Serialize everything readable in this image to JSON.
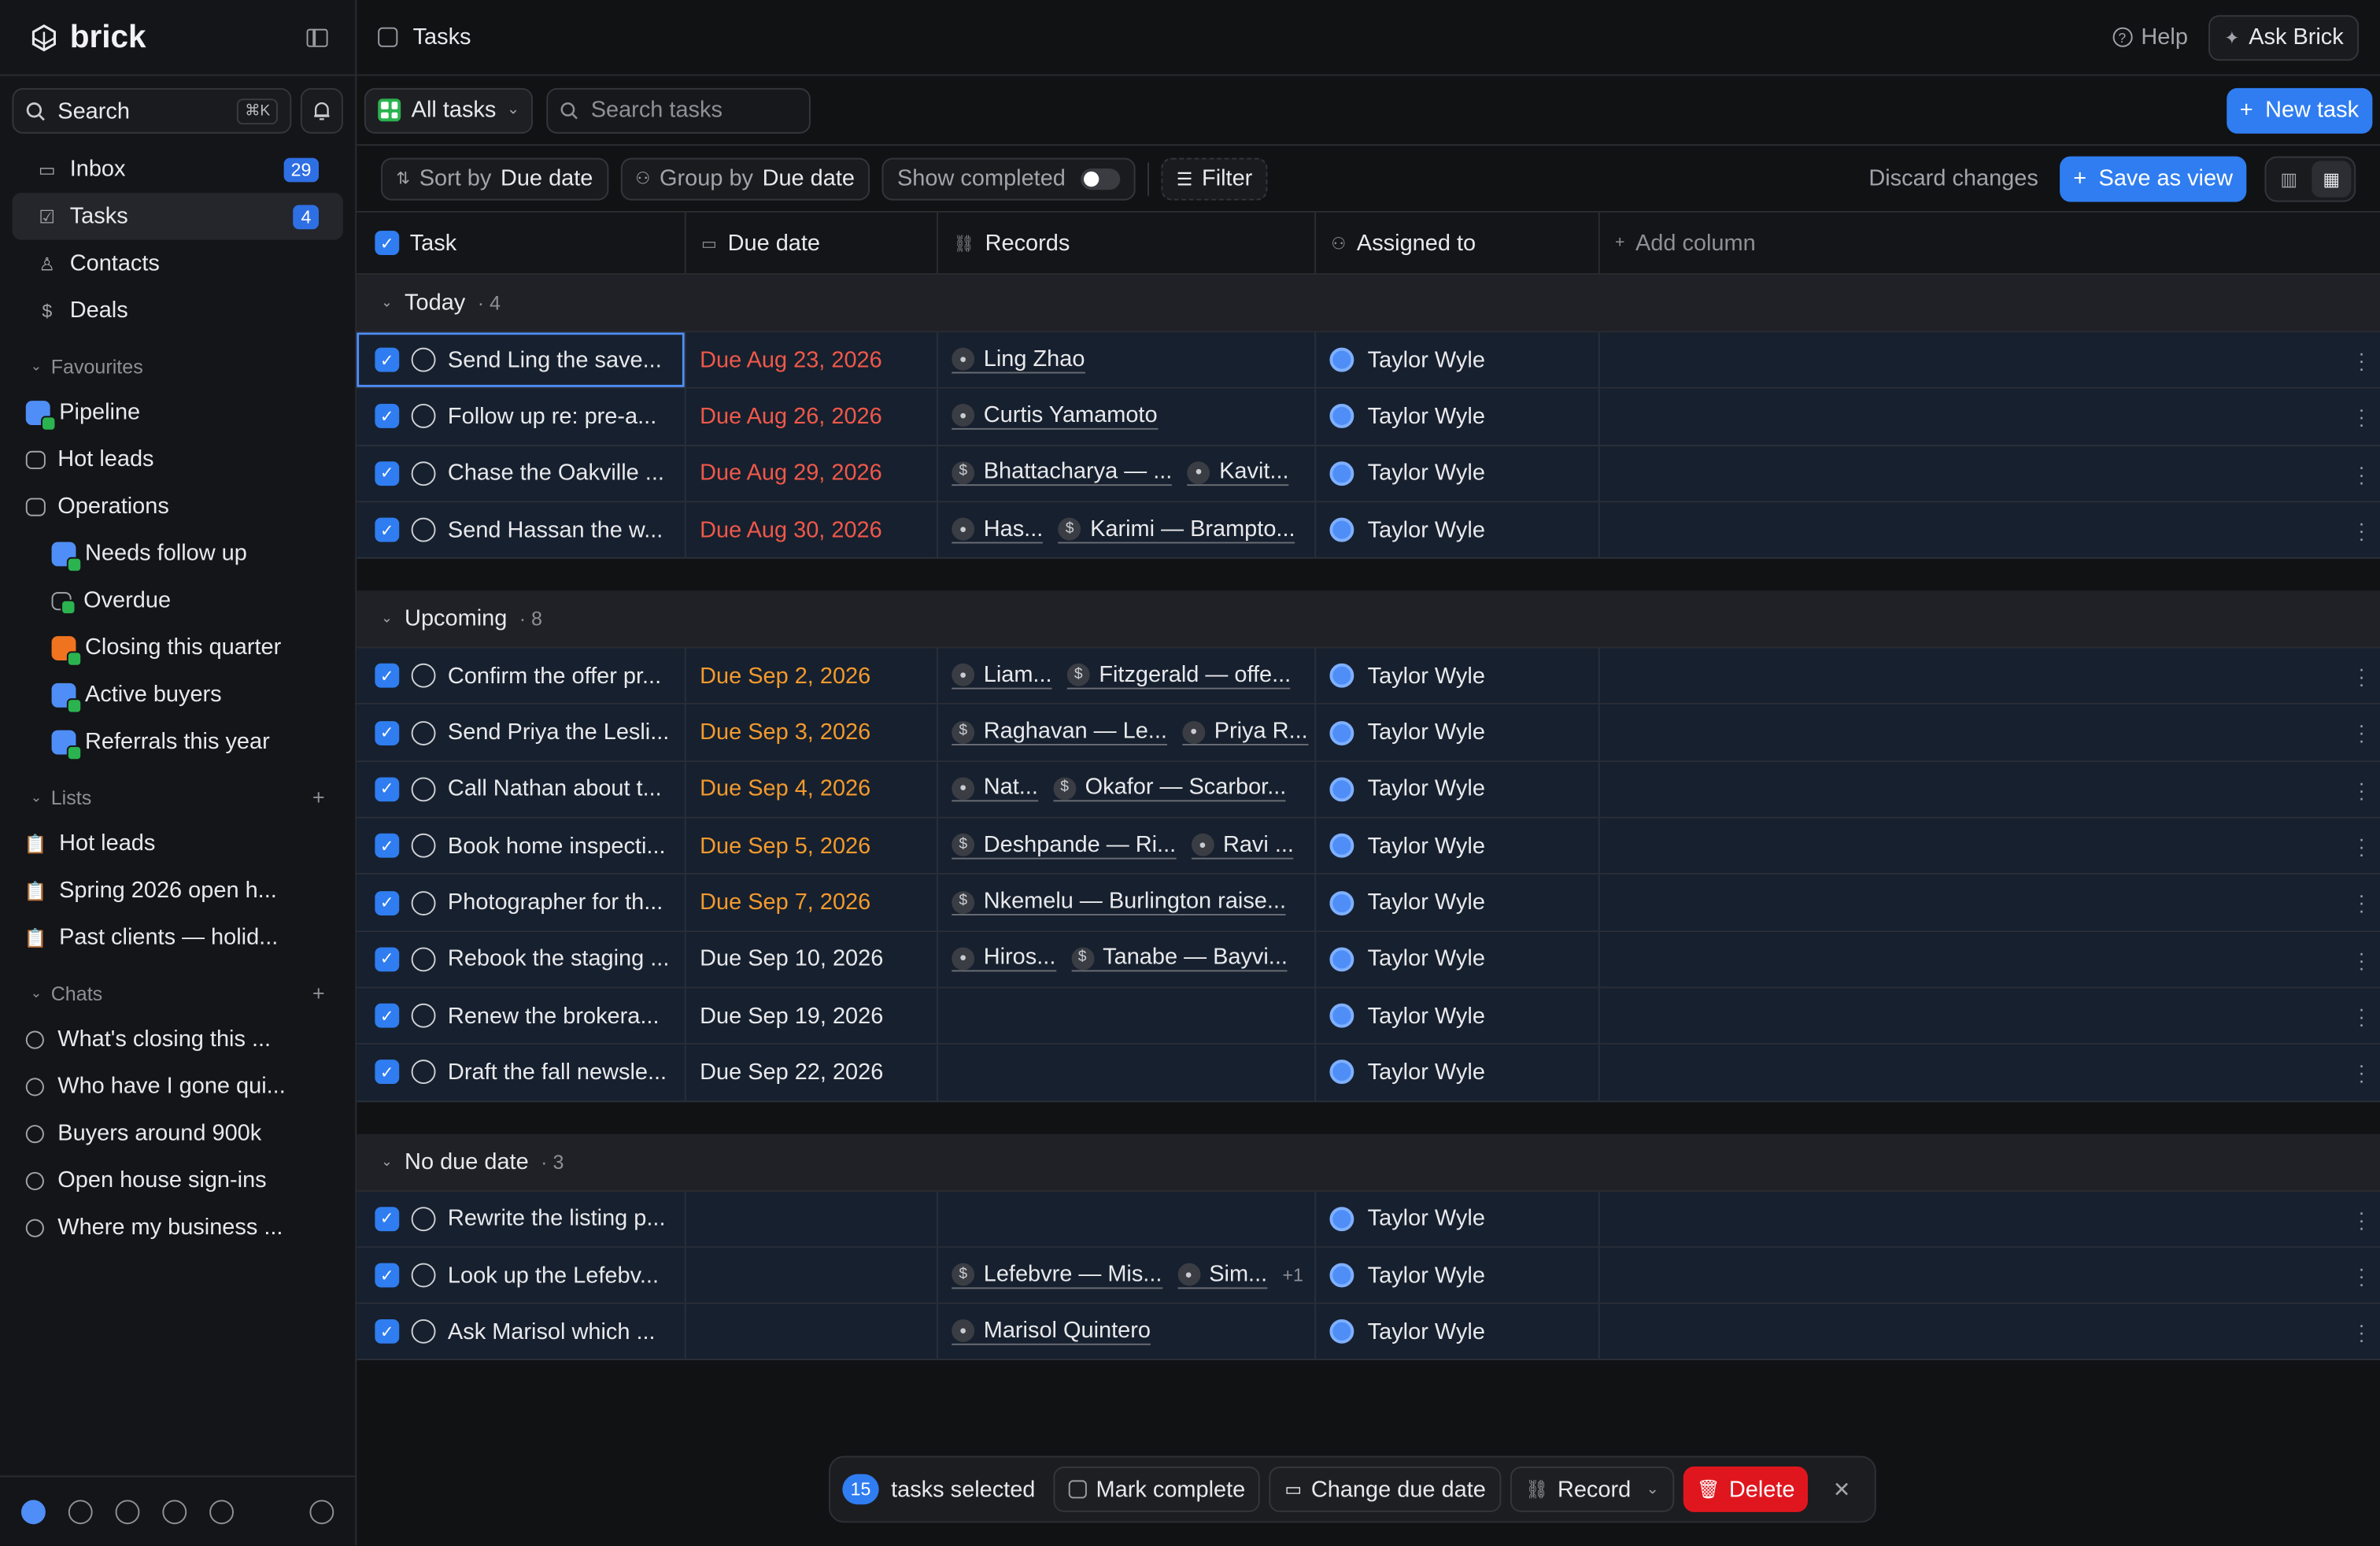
{
  "app": {
    "name": "brick"
  },
  "sidebar": {
    "search_label": "Search",
    "search_kbd": "⌘K",
    "nav": [
      {
        "label": "Inbox",
        "badge": "29"
      },
      {
        "label": "Tasks",
        "badge": "4"
      },
      {
        "label": "Contacts",
        "badge": ""
      },
      {
        "label": "Deals",
        "badge": ""
      }
    ],
    "favourites_label": "Favourites",
    "favourites": [
      {
        "label": "Pipeline",
        "indent": false
      },
      {
        "label": "Hot leads",
        "indent": false
      },
      {
        "label": "Operations",
        "indent": false
      },
      {
        "label": "Needs follow up",
        "indent": true
      },
      {
        "label": "Overdue",
        "indent": true
      },
      {
        "label": "Closing this quarter",
        "indent": true
      },
      {
        "label": "Active buyers",
        "indent": true
      },
      {
        "label": "Referrals this year",
        "indent": true
      }
    ],
    "lists_label": "Lists",
    "lists": [
      "Hot leads",
      "Spring 2026 open h...",
      "Past clients — holid..."
    ],
    "chats_label": "Chats",
    "chats": [
      "What's closing this ...",
      "Who have I gone qui...",
      "Buyers around 900k",
      "Open house sign-ins",
      "Where my business ..."
    ]
  },
  "header": {
    "title": "Tasks",
    "help": "Help",
    "ask": "Ask Brick"
  },
  "toolbar": {
    "view": "All tasks",
    "search_placeholder": "Search tasks",
    "new_task": "New task",
    "sort_prefix": "Sort by",
    "sort_value": "Due date",
    "group_prefix": "Group by",
    "group_value": "Due date",
    "show_completed": "Show completed",
    "filter": "Filter",
    "discard": "Discard changes",
    "save_view": "Save as view"
  },
  "table": {
    "columns": [
      "Task",
      "Due date",
      "Records",
      "Assigned to",
      "Add column"
    ],
    "groups": [
      {
        "name": "Today",
        "count": "· 4",
        "rows": [
          {
            "task": "Send Ling the save...",
            "due": "Due Aug 23, 2026",
            "tone": "red",
            "records": [
              "Ling Zhao"
            ],
            "extra": "",
            "assignee": "Taylor Wyle"
          },
          {
            "task": "Follow up re: pre-a...",
            "due": "Due Aug 26, 2026",
            "tone": "red",
            "records": [
              "Curtis Yamamoto"
            ],
            "extra": "",
            "assignee": "Taylor Wyle"
          },
          {
            "task": "Chase the Oakville ...",
            "due": "Due Aug 29, 2026",
            "tone": "red",
            "records": [
              "Bhattacharya — ...",
              "Kavit..."
            ],
            "extra": "",
            "assignee": "Taylor Wyle"
          },
          {
            "task": "Send Hassan the w...",
            "due": "Due Aug 30, 2026",
            "tone": "red",
            "records": [
              "Has...",
              "Karimi — Brampto..."
            ],
            "extra": "",
            "assignee": "Taylor Wyle"
          }
        ]
      },
      {
        "name": "Upcoming",
        "count": "· 8",
        "rows": [
          {
            "task": "Confirm the offer pr...",
            "due": "Due Sep 2, 2026",
            "tone": "orange",
            "records": [
              "Liam...",
              "Fitzgerald — offe..."
            ],
            "extra": "",
            "assignee": "Taylor Wyle"
          },
          {
            "task": "Send Priya the Lesli...",
            "due": "Due Sep 3, 2026",
            "tone": "orange",
            "records": [
              "Raghavan — Le...",
              "Priya R..."
            ],
            "extra": "",
            "assignee": "Taylor Wyle"
          },
          {
            "task": "Call Nathan about t...",
            "due": "Due Sep 4, 2026",
            "tone": "orange",
            "records": [
              "Nat...",
              "Okafor — Scarbor..."
            ],
            "extra": "",
            "assignee": "Taylor Wyle"
          },
          {
            "task": "Book home inspecti...",
            "due": "Due Sep 5, 2026",
            "tone": "orange",
            "records": [
              "Deshpande — Ri...",
              "Ravi ..."
            ],
            "extra": "",
            "assignee": "Taylor Wyle"
          },
          {
            "task": "Photographer for th...",
            "due": "Due Sep 7, 2026",
            "tone": "orange",
            "records": [
              "Nkemelu — Burlington raise..."
            ],
            "extra": "",
            "assignee": "Taylor Wyle"
          },
          {
            "task": "Rebook the staging ...",
            "due": "Due Sep 10, 2026",
            "tone": "white",
            "records": [
              "Hiros...",
              "Tanabe — Bayvi..."
            ],
            "extra": "",
            "assignee": "Taylor Wyle"
          },
          {
            "task": "Renew the brokera...",
            "due": "Due Sep 19, 2026",
            "tone": "white",
            "records": [],
            "extra": "",
            "assignee": "Taylor Wyle"
          },
          {
            "task": "Draft the fall newsle...",
            "due": "Due Sep 22, 2026",
            "tone": "white",
            "records": [],
            "extra": "",
            "assignee": "Taylor Wyle"
          }
        ]
      },
      {
        "name": "No due date",
        "count": "· 3",
        "rows": [
          {
            "task": "Rewrite the listing p...",
            "due": "",
            "tone": "white",
            "records": [],
            "extra": "",
            "assignee": "Taylor Wyle"
          },
          {
            "task": "Look up the Lefebv...",
            "due": "",
            "tone": "white",
            "records": [
              "Lefebvre — Mis...",
              "Sim..."
            ],
            "extra": "+1",
            "assignee": "Taylor Wyle"
          },
          {
            "task": "Ask Marisol which ...",
            "due": "",
            "tone": "white",
            "records": [
              "Marisol Quintero"
            ],
            "extra": "",
            "assignee": "Taylor Wyle"
          }
        ]
      }
    ]
  },
  "bulk": {
    "count": "15",
    "label": "tasks selected",
    "mark": "Mark complete",
    "change": "Change due date",
    "record": "Record",
    "delete": "Delete"
  },
  "colors": {
    "accent": "#2f7df0",
    "overdue": "#f0584a",
    "soon": "#f29a2e",
    "danger": "#e0161e"
  }
}
